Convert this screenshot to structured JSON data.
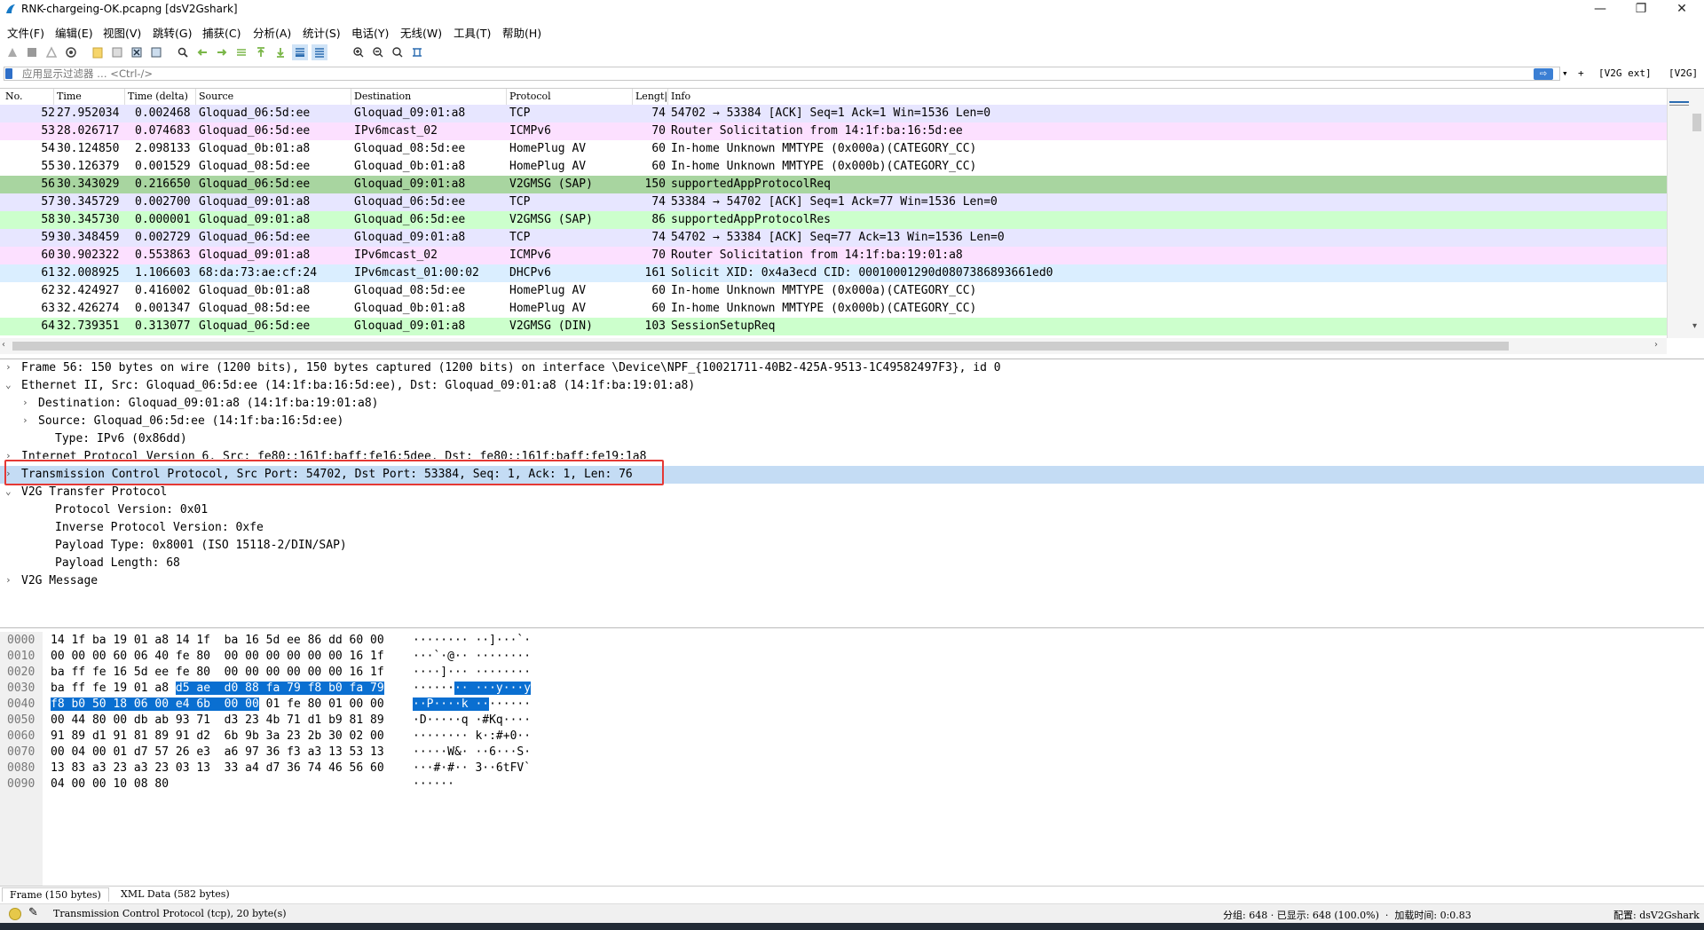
{
  "window": {
    "title": "RNK-chargeing-OK.pcapng [dsV2Gshark]",
    "minimize": "—",
    "maximize": "❐",
    "close": "✕"
  },
  "menu": [
    "文件(F)",
    "编辑(E)",
    "视图(V)",
    "跳转(G)",
    "捕获(C)",
    "分析(A)",
    "统计(S)",
    "电话(Y)",
    "无线(W)",
    "工具(T)",
    "帮助(H)"
  ],
  "filter": {
    "placeholder": "应用显示过滤器 … <Ctrl-/>",
    "apply": "⇨",
    "plus": "+",
    "btn1": "[V2G ext]",
    "btn2": "[V2G]"
  },
  "columns": [
    "No.",
    "Time",
    "Time (delta)",
    "Source",
    "Destination",
    "Protocol",
    "Lengt|",
    "Info"
  ],
  "packets": [
    {
      "no": "52",
      "time": "27.952034",
      "delta": "0.002468",
      "src": "Gloquad_06:5d:ee",
      "dst": "Gloquad_09:01:a8",
      "proto": "TCP",
      "len": "74",
      "info": "54702 → 53384 [ACK] Seq=1 Ack=1 Win=1536 Len=0",
      "bg": "#e7e6ff"
    },
    {
      "no": "53",
      "time": "28.026717",
      "delta": "0.074683",
      "src": "Gloquad_06:5d:ee",
      "dst": "IPv6mcast_02",
      "proto": "ICMPv6",
      "len": "70",
      "info": "Router Solicitation from 14:1f:ba:16:5d:ee",
      "bg": "#fce0ff"
    },
    {
      "no": "54",
      "time": "30.124850",
      "delta": "2.098133",
      "src": "Gloquad_0b:01:a8",
      "dst": "Gloquad_08:5d:ee",
      "proto": "HomePlug AV",
      "len": "60",
      "info": "In-home Unknown MMTYPE (0x000a)(CATEGORY_CC)",
      "bg": "#ffffff"
    },
    {
      "no": "55",
      "time": "30.126379",
      "delta": "0.001529",
      "src": "Gloquad_08:5d:ee",
      "dst": "Gloquad_0b:01:a8",
      "proto": "HomePlug AV",
      "len": "60",
      "info": "In-home Unknown MMTYPE (0x000b)(CATEGORY_CC)",
      "bg": "#ffffff"
    },
    {
      "no": "56",
      "time": "30.343029",
      "delta": "0.216650",
      "src": "Gloquad_06:5d:ee",
      "dst": "Gloquad_09:01:a8",
      "proto": "V2GMSG (SAP)",
      "len": "150",
      "info": "supportedAppProtocolReq",
      "bg": "#a8d5a0"
    },
    {
      "no": "57",
      "time": "30.345729",
      "delta": "0.002700",
      "src": "Gloquad_09:01:a8",
      "dst": "Gloquad_06:5d:ee",
      "proto": "TCP",
      "len": "74",
      "info": "53384 → 54702 [ACK] Seq=1 Ack=77 Win=1536 Len=0",
      "bg": "#e7e6ff"
    },
    {
      "no": "58",
      "time": "30.345730",
      "delta": "0.000001",
      "src": "Gloquad_09:01:a8",
      "dst": "Gloquad_06:5d:ee",
      "proto": "V2GMSG (SAP)",
      "len": "86",
      "info": "supportedAppProtocolRes",
      "bg": "#ccffcc"
    },
    {
      "no": "59",
      "time": "30.348459",
      "delta": "0.002729",
      "src": "Gloquad_06:5d:ee",
      "dst": "Gloquad_09:01:a8",
      "proto": "TCP",
      "len": "74",
      "info": "54702 → 53384 [ACK] Seq=77 Ack=13 Win=1536 Len=0",
      "bg": "#e7e6ff"
    },
    {
      "no": "60",
      "time": "30.902322",
      "delta": "0.553863",
      "src": "Gloquad_09:01:a8",
      "dst": "IPv6mcast_02",
      "proto": "ICMPv6",
      "len": "70",
      "info": "Router Solicitation from 14:1f:ba:19:01:a8",
      "bg": "#fce0ff"
    },
    {
      "no": "61",
      "time": "32.008925",
      "delta": "1.106603",
      "src": "68:da:73:ae:cf:24",
      "dst": "IPv6mcast_01:00:02",
      "proto": "DHCPv6",
      "len": "161",
      "info": "Solicit XID: 0x4a3ecd CID: 00010001290d0807386893661ed0",
      "bg": "#daeeff"
    },
    {
      "no": "62",
      "time": "32.424927",
      "delta": "0.416002",
      "src": "Gloquad_0b:01:a8",
      "dst": "Gloquad_08:5d:ee",
      "proto": "HomePlug AV",
      "len": "60",
      "info": "In-home Unknown MMTYPE (0x000a)(CATEGORY_CC)",
      "bg": "#ffffff"
    },
    {
      "no": "63",
      "time": "32.426274",
      "delta": "0.001347",
      "src": "Gloquad_08:5d:ee",
      "dst": "Gloquad_0b:01:a8",
      "proto": "HomePlug AV",
      "len": "60",
      "info": "In-home Unknown MMTYPE (0x000b)(CATEGORY_CC)",
      "bg": "#ffffff"
    },
    {
      "no": "64",
      "time": "32.739351",
      "delta": "0.313077",
      "src": "Gloquad_06:5d:ee",
      "dst": "Gloquad_09:01:a8",
      "proto": "V2GMSG (DIN)",
      "len": "103",
      "info": "SessionSetupReq",
      "bg": "#ccffcc"
    }
  ],
  "details": [
    {
      "arrow": "›",
      "indent": 0,
      "text": "Frame 56: 150 bytes on wire (1200 bits), 150 bytes captured (1200 bits) on interface \\Device\\NPF_{10021711-40B2-425A-9513-1C49582497F3}, id 0",
      "bg": "#ffffff"
    },
    {
      "arrow": "⌄",
      "indent": 0,
      "text": "Ethernet II, Src: Gloquad_06:5d:ee (14:1f:ba:16:5d:ee), Dst: Gloquad_09:01:a8 (14:1f:ba:19:01:a8)",
      "bg": "#ffffff"
    },
    {
      "arrow": "›",
      "indent": 1,
      "text": "Destination: Gloquad_09:01:a8 (14:1f:ba:19:01:a8)",
      "bg": "#ffffff"
    },
    {
      "arrow": "›",
      "indent": 1,
      "text": "Source: Gloquad_06:5d:ee (14:1f:ba:16:5d:ee)",
      "bg": "#ffffff"
    },
    {
      "arrow": "",
      "indent": 2,
      "text": "Type: IPv6 (0x86dd)",
      "bg": "#ffffff"
    },
    {
      "arrow": "›",
      "indent": 0,
      "text": "Internet Protocol Version 6, Src: fe80::161f:baff:fe16:5dee, Dst: fe80::161f:baff:fe19:1a8",
      "bg": "#ffffff"
    },
    {
      "arrow": "›",
      "indent": 0,
      "text": "Transmission Control Protocol, Src Port: 54702, Dst Port: 53384, Seq: 1, Ack: 1, Len: 76",
      "bg": "#c4dcf4"
    },
    {
      "arrow": "⌄",
      "indent": 0,
      "text": "V2G Transfer Protocol",
      "bg": "#ffffff"
    },
    {
      "arrow": "",
      "indent": 2,
      "text": "Protocol Version: 0x01",
      "bg": "#ffffff"
    },
    {
      "arrow": "",
      "indent": 2,
      "text": "Inverse Protocol Version: 0xfe",
      "bg": "#ffffff"
    },
    {
      "arrow": "",
      "indent": 2,
      "text": "Payload Type: 0x8001 (ISO 15118-2/DIN/SAP)",
      "bg": "#ffffff"
    },
    {
      "arrow": "",
      "indent": 2,
      "text": "Payload Length: 68",
      "bg": "#ffffff"
    },
    {
      "arrow": "›",
      "indent": 0,
      "text": "V2G Message",
      "bg": "#ffffff"
    }
  ],
  "bytes": [
    {
      "off": "0000",
      "hex": [
        [
          "14 1f ba 19 01 a8 14 1f  ba 16 5d ee 86 dd 60 00",
          ""
        ]
      ],
      "asc": [
        [
          "········ ··]···`·",
          ""
        ]
      ]
    },
    {
      "off": "0010",
      "hex": [
        [
          "00 00 00 60 06 40 fe 80  00 00 00 00 00 00 16 1f",
          ""
        ]
      ],
      "asc": [
        [
          "···`·@·· ········",
          ""
        ]
      ]
    },
    {
      "off": "0020",
      "hex": [
        [
          "ba ff fe 16 5d ee fe 80  00 00 00 00 00 00 16 1f",
          ""
        ]
      ],
      "asc": [
        [
          "····]··· ········",
          ""
        ]
      ]
    },
    {
      "off": "0030",
      "hex": [
        [
          "ba ff fe 19 01 a8 ",
          ""
        ],
        [
          "d5 ae  d0 88 fa 79 f8 b0 fa 79",
          "sel"
        ]
      ],
      "asc": [
        [
          "······",
          ""
        ],
        [
          "·· ···y···y",
          "sel"
        ]
      ]
    },
    {
      "off": "0040",
      "hex": [
        [
          "f8 b0 50 18 06 00 e4 6b  00 00",
          "sel"
        ],
        [
          " 01 fe 80 01 00 00",
          ""
        ]
      ],
      "asc": [
        [
          "··P····k ··",
          "sel"
        ],
        [
          "······",
          ""
        ]
      ]
    },
    {
      "off": "0050",
      "hex": [
        [
          "00 44 80 00 db ab 93 71  d3 23 4b 71 d1 b9 81 89",
          ""
        ]
      ],
      "asc": [
        [
          "·D·····q ·#Kq····",
          ""
        ]
      ]
    },
    {
      "off": "0060",
      "hex": [
        [
          "91 89 d1 91 81 89 91 d2  6b 9b 3a 23 2b 30 02 00",
          ""
        ]
      ],
      "asc": [
        [
          "········ k·:#+0··",
          ""
        ]
      ]
    },
    {
      "off": "0070",
      "hex": [
        [
          "00 04 00 01 d7 57 26 e3  a6 97 36 f3 a3 13 53 13",
          ""
        ]
      ],
      "asc": [
        [
          "·····W&· ··6···S·",
          ""
        ]
      ]
    },
    {
      "off": "0080",
      "hex": [
        [
          "13 83 a3 23 a3 23 03 13  33 a4 d7 36 74 46 56 60",
          ""
        ]
      ],
      "asc": [
        [
          "···#·#·· 3··6tFV`",
          ""
        ]
      ]
    },
    {
      "off": "0090",
      "hex": [
        [
          "04 00 00 10 08 80",
          ""
        ]
      ],
      "asc": [
        [
          "······",
          ""
        ]
      ]
    }
  ],
  "bytetabs": [
    "Frame (150 bytes)",
    "XML Data (582 bytes)"
  ],
  "status": {
    "proto": "Transmission Control Protocol (tcp), 20 byte(s)",
    "groups": "分组: 648 · 已显示: 648 (100.0%)  ·  加载时间: 0:0.83",
    "profile": "配置: dsV2Gshark"
  },
  "colors": {
    "accent": "#0a6fd1",
    "highlight_box": "#e53935",
    "selected_detail": "#c4dcf4"
  }
}
